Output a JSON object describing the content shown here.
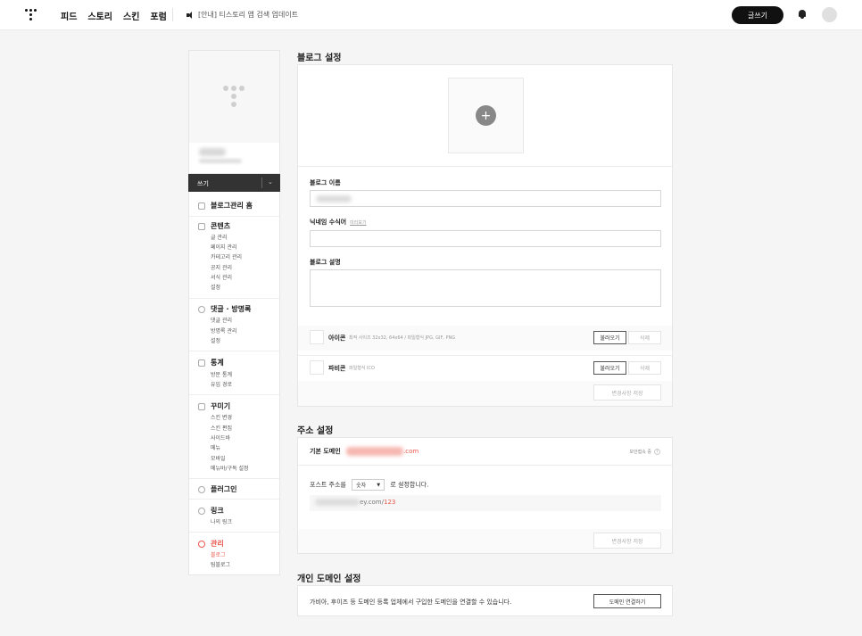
{
  "topbar": {
    "nav": [
      "피드",
      "스토리",
      "스킨",
      "포럼"
    ],
    "notice": "[안내] 티스토리 앱 검색 업데이트",
    "write_label": "글쓰기",
    "avatar_text": "프로필"
  },
  "sidebar": {
    "write_label": "쓰기",
    "home": "블로그관리 홈",
    "groups": {
      "content": {
        "title": "콘텐츠",
        "items": [
          "글 관리",
          "페이지 관리",
          "카테고리 관리",
          "공지 관리",
          "서식 관리",
          "설정"
        ]
      },
      "comment": {
        "title": "댓글 · 방명록",
        "items": [
          "댓글 관리",
          "방명록 관리",
          "설정"
        ]
      },
      "stats": {
        "title": "통계",
        "items": [
          "방문 통계",
          "유입 경로"
        ]
      },
      "decorate": {
        "title": "꾸미기",
        "items": [
          "스킨 변경",
          "스킨 편집",
          "사이드바",
          "메뉴",
          "모바일",
          "메뉴바/구독 설정"
        ]
      },
      "plugin": {
        "title": "플러그인"
      },
      "link": {
        "title": "링크",
        "items": [
          "나의 링크"
        ]
      },
      "manage": {
        "title": "관리",
        "items": [
          "블로그",
          "팀블로그"
        ]
      }
    }
  },
  "blog_settings": {
    "title": "블로그 설정",
    "name_label": "블로그 이름",
    "nickname_label": "닉네임 수식어",
    "nickname_link": "미리보기",
    "desc_label": "블로그 설명",
    "icon_label": "아이콘",
    "icon_desc": "최적 사이즈 32x32, 64x64 / 파일형식 JPG, GIF, PNG",
    "favicon_label": "파비콘",
    "favicon_desc": "파일형식 ICO",
    "upload_label": "불러오기",
    "delete_label": "삭제",
    "save_label": "변경사항 저장"
  },
  "address_settings": {
    "title": "주소 설정",
    "default_domain_label": "기본 도메인",
    "default_domain_suffix": ".com",
    "secure_label": "보안접속 중",
    "post_addr_label": "포스트 주소를",
    "post_addr_option": "숫자",
    "post_addr_suffix": "로 설정합니다.",
    "example_mid": "ey.com/",
    "example_num": "123",
    "save_label": "변경사항 저장"
  },
  "personal_domain": {
    "title": "개인 도메인 설정",
    "desc": "가비아, 후이즈 등 도메인 등록 업체에서 구입한 도메인을 연결할 수 있습니다.",
    "connect_label": "도메인 연결하기"
  },
  "colors": {
    "accent": "#e8574a",
    "dark": "#111111"
  }
}
